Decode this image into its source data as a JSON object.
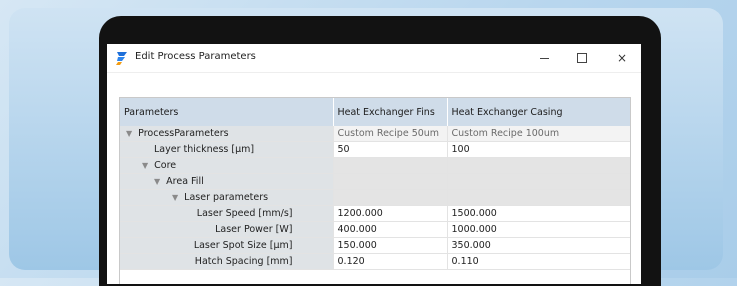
{
  "window": {
    "title": "Edit Process Parameters",
    "icon": "app-logo-icon",
    "controls": {
      "minimize": "minimize-icon",
      "maximize": "maximize-icon",
      "close": "×"
    }
  },
  "grid": {
    "headers": [
      "Parameters",
      "Heat Exchanger Fins",
      "Heat Exchanger Casing"
    ],
    "rows": [
      {
        "label": "ProcessParameters",
        "values": [
          "Custom Recipe 50um",
          "Custom Recipe 100um"
        ]
      },
      {
        "label": "Layer thickness [µm]",
        "values": [
          "50",
          "100"
        ]
      },
      {
        "label": "Core",
        "values": [
          "",
          ""
        ]
      },
      {
        "label": "Area Fill",
        "values": [
          "",
          ""
        ]
      },
      {
        "label": "Laser parameters",
        "values": [
          "",
          ""
        ]
      },
      {
        "label": "Laser Speed [mm/s]",
        "values": [
          "1200.000",
          "1500.000"
        ]
      },
      {
        "label": "Laser Power [W]",
        "values": [
          "400.000",
          "1000.000"
        ]
      },
      {
        "label": "Laser Spot Size [µm]",
        "values": [
          "150.000",
          "350.000"
        ]
      },
      {
        "label": "Hatch Spacing [mm]",
        "values": [
          "0.120",
          "0.110"
        ]
      }
    ]
  },
  "colors": {
    "accent_logo": "#1e6fd9",
    "header_bg": "#cfdce9",
    "name_cell_bg": "#dfe3e6"
  }
}
